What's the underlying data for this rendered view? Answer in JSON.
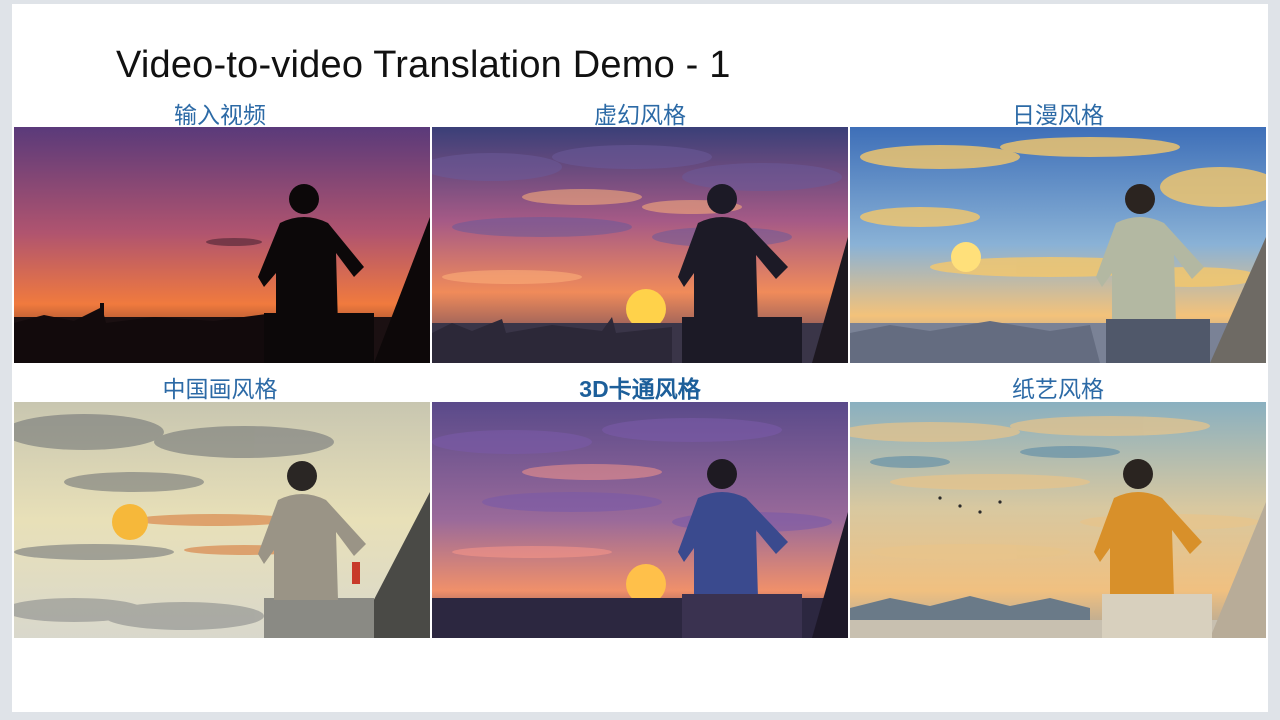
{
  "slide": {
    "title": "Video-to-video Translation Demo - 1",
    "panels": [
      {
        "label": "输入视频",
        "scene": "input-silhouette-sunset"
      },
      {
        "label": "虚幻风格",
        "scene": "unreal-style-sunset"
      },
      {
        "label": "日漫风格",
        "scene": "anime-style-sunset"
      },
      {
        "label": "中国画风格",
        "scene": "chinese-painting-sunset"
      },
      {
        "label": "3D卡通风格",
        "scene": "3d-cartoon-sunset"
      },
      {
        "label": "纸艺风格",
        "scene": "paper-art-sunset"
      }
    ]
  }
}
